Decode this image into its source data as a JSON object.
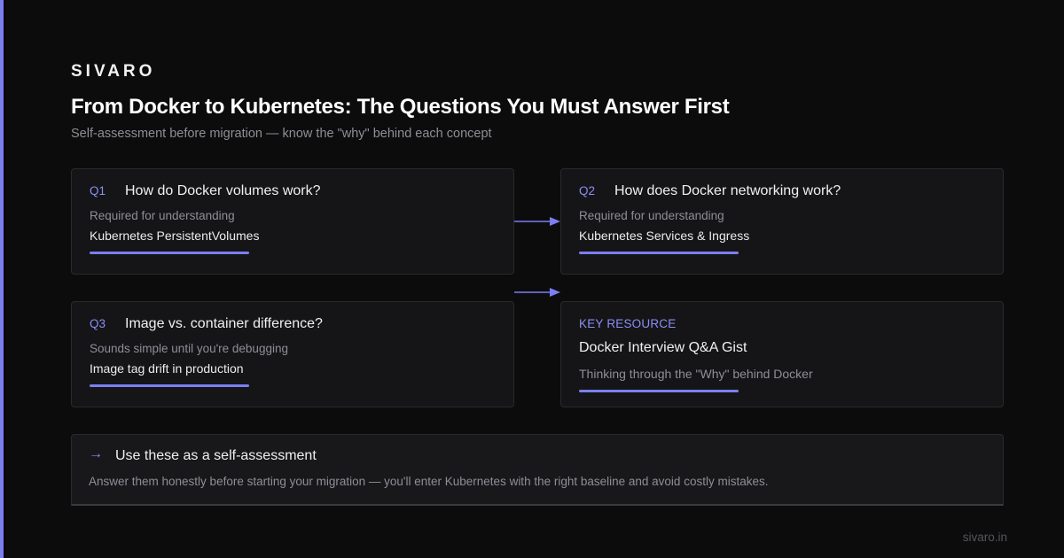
{
  "brand": "SIVARO",
  "title": "From Docker to Kubernetes: The Questions You Must Answer First",
  "subtitle": "Self-assessment before migration — know the \"why\" behind each concept",
  "questions": [
    {
      "number": "Q1",
      "question": "How do Docker volumes work?",
      "context": "Required for understanding",
      "topic": "Kubernetes PersistentVolumes"
    },
    {
      "number": "Q2",
      "question": "How does Docker networking work?",
      "context": "Required for understanding",
      "topic": "Kubernetes Services & Ingress"
    },
    {
      "number": "Q3",
      "question": "Image vs. container difference?",
      "context": "Sounds simple until you're debugging",
      "topic": "Image tag drift in production"
    }
  ],
  "resource": {
    "label": "KEY RESOURCE",
    "title": "Docker Interview Q&A Gist",
    "description": "Thinking through the \"Why\" behind Docker"
  },
  "summary": {
    "arrow_icon": "arrow-right-icon",
    "title": "Use these as a self-assessment",
    "description": "Answer them honestly before starting your migration — you'll enter Kubernetes with the right baseline and avoid costly mistakes."
  },
  "footer": "sivaro.in",
  "colors": {
    "background": "#0c0c0d",
    "accent": "#7b7ff2",
    "card": "#151517",
    "border": "#2a2a2e",
    "muted_text": "#8e8e96"
  }
}
